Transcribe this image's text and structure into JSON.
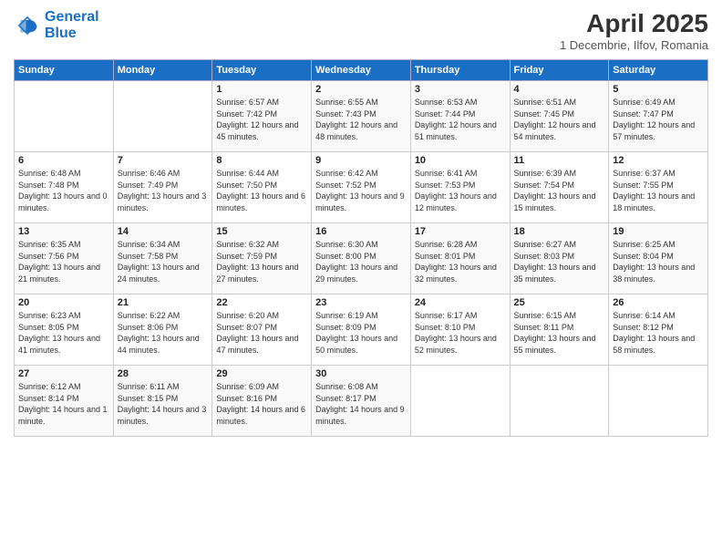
{
  "logo": {
    "line1": "General",
    "line2": "Blue"
  },
  "title": "April 2025",
  "subtitle": "1 Decembrie, Ilfov, Romania",
  "weekdays": [
    "Sunday",
    "Monday",
    "Tuesday",
    "Wednesday",
    "Thursday",
    "Friday",
    "Saturday"
  ],
  "weeks": [
    [
      {
        "day": "",
        "content": ""
      },
      {
        "day": "",
        "content": ""
      },
      {
        "day": "1",
        "content": "Sunrise: 6:57 AM\nSunset: 7:42 PM\nDaylight: 12 hours and 45 minutes."
      },
      {
        "day": "2",
        "content": "Sunrise: 6:55 AM\nSunset: 7:43 PM\nDaylight: 12 hours and 48 minutes."
      },
      {
        "day": "3",
        "content": "Sunrise: 6:53 AM\nSunset: 7:44 PM\nDaylight: 12 hours and 51 minutes."
      },
      {
        "day": "4",
        "content": "Sunrise: 6:51 AM\nSunset: 7:45 PM\nDaylight: 12 hours and 54 minutes."
      },
      {
        "day": "5",
        "content": "Sunrise: 6:49 AM\nSunset: 7:47 PM\nDaylight: 12 hours and 57 minutes."
      }
    ],
    [
      {
        "day": "6",
        "content": "Sunrise: 6:48 AM\nSunset: 7:48 PM\nDaylight: 13 hours and 0 minutes."
      },
      {
        "day": "7",
        "content": "Sunrise: 6:46 AM\nSunset: 7:49 PM\nDaylight: 13 hours and 3 minutes."
      },
      {
        "day": "8",
        "content": "Sunrise: 6:44 AM\nSunset: 7:50 PM\nDaylight: 13 hours and 6 minutes."
      },
      {
        "day": "9",
        "content": "Sunrise: 6:42 AM\nSunset: 7:52 PM\nDaylight: 13 hours and 9 minutes."
      },
      {
        "day": "10",
        "content": "Sunrise: 6:41 AM\nSunset: 7:53 PM\nDaylight: 13 hours and 12 minutes."
      },
      {
        "day": "11",
        "content": "Sunrise: 6:39 AM\nSunset: 7:54 PM\nDaylight: 13 hours and 15 minutes."
      },
      {
        "day": "12",
        "content": "Sunrise: 6:37 AM\nSunset: 7:55 PM\nDaylight: 13 hours and 18 minutes."
      }
    ],
    [
      {
        "day": "13",
        "content": "Sunrise: 6:35 AM\nSunset: 7:56 PM\nDaylight: 13 hours and 21 minutes."
      },
      {
        "day": "14",
        "content": "Sunrise: 6:34 AM\nSunset: 7:58 PM\nDaylight: 13 hours and 24 minutes."
      },
      {
        "day": "15",
        "content": "Sunrise: 6:32 AM\nSunset: 7:59 PM\nDaylight: 13 hours and 27 minutes."
      },
      {
        "day": "16",
        "content": "Sunrise: 6:30 AM\nSunset: 8:00 PM\nDaylight: 13 hours and 29 minutes."
      },
      {
        "day": "17",
        "content": "Sunrise: 6:28 AM\nSunset: 8:01 PM\nDaylight: 13 hours and 32 minutes."
      },
      {
        "day": "18",
        "content": "Sunrise: 6:27 AM\nSunset: 8:03 PM\nDaylight: 13 hours and 35 minutes."
      },
      {
        "day": "19",
        "content": "Sunrise: 6:25 AM\nSunset: 8:04 PM\nDaylight: 13 hours and 38 minutes."
      }
    ],
    [
      {
        "day": "20",
        "content": "Sunrise: 6:23 AM\nSunset: 8:05 PM\nDaylight: 13 hours and 41 minutes."
      },
      {
        "day": "21",
        "content": "Sunrise: 6:22 AM\nSunset: 8:06 PM\nDaylight: 13 hours and 44 minutes."
      },
      {
        "day": "22",
        "content": "Sunrise: 6:20 AM\nSunset: 8:07 PM\nDaylight: 13 hours and 47 minutes."
      },
      {
        "day": "23",
        "content": "Sunrise: 6:19 AM\nSunset: 8:09 PM\nDaylight: 13 hours and 50 minutes."
      },
      {
        "day": "24",
        "content": "Sunrise: 6:17 AM\nSunset: 8:10 PM\nDaylight: 13 hours and 52 minutes."
      },
      {
        "day": "25",
        "content": "Sunrise: 6:15 AM\nSunset: 8:11 PM\nDaylight: 13 hours and 55 minutes."
      },
      {
        "day": "26",
        "content": "Sunrise: 6:14 AM\nSunset: 8:12 PM\nDaylight: 13 hours and 58 minutes."
      }
    ],
    [
      {
        "day": "27",
        "content": "Sunrise: 6:12 AM\nSunset: 8:14 PM\nDaylight: 14 hours and 1 minute."
      },
      {
        "day": "28",
        "content": "Sunrise: 6:11 AM\nSunset: 8:15 PM\nDaylight: 14 hours and 3 minutes."
      },
      {
        "day": "29",
        "content": "Sunrise: 6:09 AM\nSunset: 8:16 PM\nDaylight: 14 hours and 6 minutes."
      },
      {
        "day": "30",
        "content": "Sunrise: 6:08 AM\nSunset: 8:17 PM\nDaylight: 14 hours and 9 minutes."
      },
      {
        "day": "",
        "content": ""
      },
      {
        "day": "",
        "content": ""
      },
      {
        "day": "",
        "content": ""
      }
    ]
  ]
}
